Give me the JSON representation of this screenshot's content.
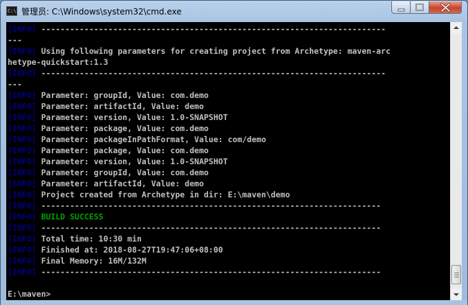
{
  "window": {
    "title": "管理员: C:\\Windows\\system32\\cmd.exe",
    "icon_label": "C:\\"
  },
  "console": {
    "lines": [
      {
        "tag": "[INFO]",
        "text": " ------------------------------------------------------------------------"
      },
      {
        "tag": "",
        "text": "---"
      },
      {
        "tag": "[INFO]",
        "text": " Using following parameters for creating project from Archetype: maven-arc"
      },
      {
        "tag": "",
        "text": "hetype-quickstart:1.3"
      },
      {
        "tag": "[INFO]",
        "text": " ------------------------------------------------------------------------"
      },
      {
        "tag": "",
        "text": "---"
      },
      {
        "tag": "[INFO]",
        "text": " Parameter: groupId, Value: com.demo"
      },
      {
        "tag": "[INFO]",
        "text": " Parameter: artifactId, Value: demo"
      },
      {
        "tag": "[INFO]",
        "text": " Parameter: version, Value: 1.0-SNAPSHOT"
      },
      {
        "tag": "[INFO]",
        "text": " Parameter: package, Value: com.demo"
      },
      {
        "tag": "[INFO]",
        "text": " Parameter: packageInPathFormat, Value: com/demo"
      },
      {
        "tag": "[INFO]",
        "text": " Parameter: package, Value: com.demo"
      },
      {
        "tag": "[INFO]",
        "text": " Parameter: version, Value: 1.0-SNAPSHOT"
      },
      {
        "tag": "[INFO]",
        "text": " Parameter: groupId, Value: com.demo"
      },
      {
        "tag": "[INFO]",
        "text": " Parameter: artifactId, Value: demo"
      },
      {
        "tag": "[INFO]",
        "text": " Project created from Archetype in dir: E:\\maven\\demo"
      },
      {
        "tag": "[INFO]",
        "text": " -----------------------------------------------------------------------"
      },
      {
        "tag": "[INFO]",
        "text": " BUILD SUCCESS",
        "green": true
      },
      {
        "tag": "[INFO]",
        "text": " -----------------------------------------------------------------------"
      },
      {
        "tag": "[INFO]",
        "text": " Total time: 10:30 min"
      },
      {
        "tag": "[INFO]",
        "text": " Finished at: 2018-08-27T19:47:06+08:00"
      },
      {
        "tag": "[INFO]",
        "text": " Final Memory: 16M/132M"
      },
      {
        "tag": "[INFO]",
        "text": " -----------------------------------------------------------------------"
      },
      {
        "tag": "",
        "text": ""
      },
      {
        "tag": "",
        "text": "E:\\maven>"
      }
    ]
  },
  "colors": {
    "console_bg": "#000000",
    "console_text": "#c0c0c0",
    "info_tag": "#000080",
    "success": "#00a000"
  },
  "icons": [
    "cmd-app-icon",
    "minimize-icon",
    "maximize-icon",
    "close-icon",
    "scroll-up-icon",
    "scroll-down-icon"
  ]
}
